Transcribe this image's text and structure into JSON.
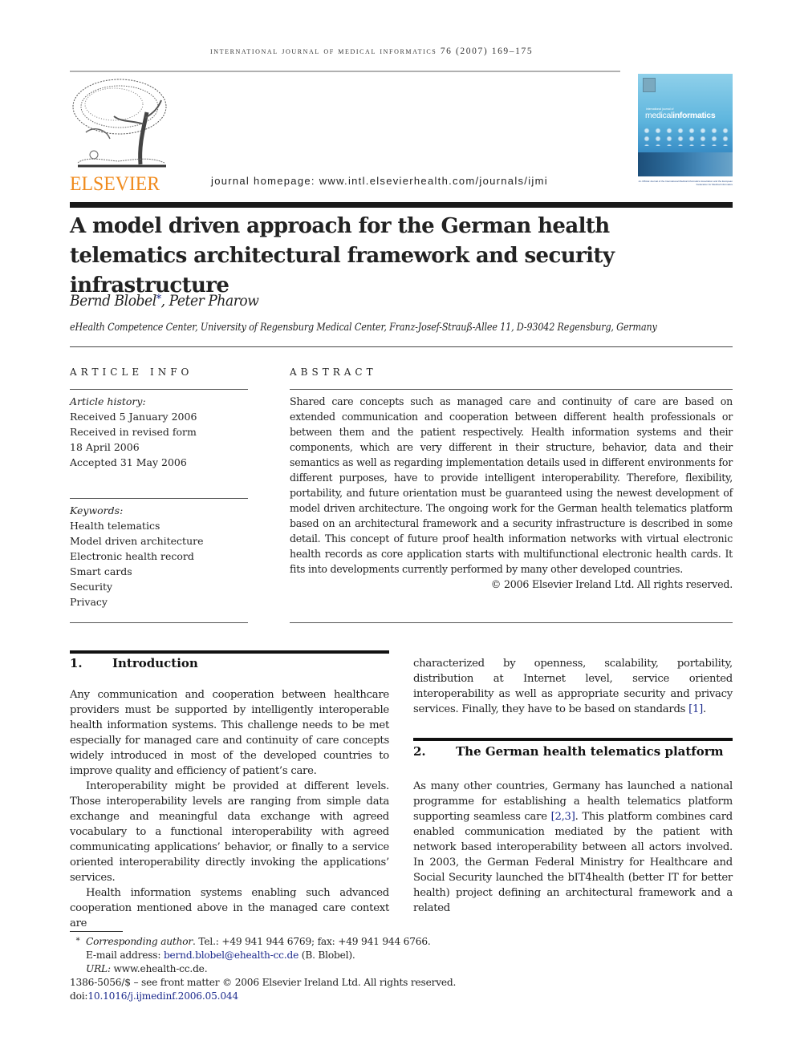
{
  "header": {
    "running_head": "international journal of medical informatics 76 (2007) 169–175",
    "publisher_logo_text": "ELSEVIER",
    "homepage": "journal homepage: www.intl.elsevierhealth.com/journals/ijmi",
    "cover": {
      "kicker": "international journal of",
      "title_light": "medical",
      "title_bold": "informatics",
      "caption": "An Official Journal of the International Medical Informatics Association and the European Federation for Medical Informatics"
    },
    "brand_color": "#f08a1c",
    "link_color": "#1c2a8c"
  },
  "article": {
    "title": "A model driven approach for the German health telematics architectural framework and security infrastructure",
    "authors": [
      {
        "name": "Bernd Blobel",
        "corresponding_mark": "*"
      },
      {
        "name": "Peter Pharow"
      }
    ],
    "author_separator": ", ",
    "affiliation": "eHealth Competence Center, University of Regensburg Medical Center, Franz-Josef-Strauß-Allee 11, D-93042 Regensburg, Germany"
  },
  "article_info": {
    "label": "ARTICLE INFO",
    "history_label": "Article history:",
    "history": [
      "Received 5 January 2006",
      "Received in revised form",
      "18 April 2006",
      "Accepted 31 May 2006"
    ],
    "keywords_label": "Keywords:",
    "keywords": [
      "Health telematics",
      "Model driven architecture",
      "Electronic health record",
      "Smart cards",
      "Security",
      "Privacy"
    ]
  },
  "abstract": {
    "label": "ABSTRACT",
    "text": "Shared care concepts such as managed care and continuity of care are based on extended communication and cooperation between different health professionals or between them and the patient respectively. Health information systems and their components, which are very different in their structure, behavior, data and their semantics as well as regarding implementation details used in different environments for different purposes, have to provide intelligent interoperability. Therefore, flexibility, portability, and future orientation must be guaranteed using the newest development of model driven architecture. The ongoing work for the German health telematics platform based on an architectural framework and a security infrastructure is described in some detail. This concept of future proof health information networks with virtual electronic health records as core application starts with multifunctional electronic health cards. It fits into developments currently performed by many other developed countries.",
    "copyright": "© 2006 Elsevier Ireland Ltd. All rights reserved."
  },
  "sections": [
    {
      "number": "1.",
      "title": "Introduction",
      "paragraphs": [
        "Any communication and cooperation between healthcare providers must be supported by intelligently interoperable health information systems. This challenge needs to be met especially for managed care and continuity of care concepts widely introduced in most of the developed countries to improve quality and efficiency of patient’s care.",
        "Interoperability might be provided at different levels. Those interoperability levels are ranging from simple data exchange and meaningful data exchange with agreed vocabulary to a functional interoperability with agreed communicating applications’ behavior, or finally to a service oriented interoperability directly invoking the applications’ services.",
        "Health information systems enabling such advanced cooperation mentioned above in the managed care context are"
      ],
      "continuation": {
        "text": "characterized by openness, scalability, portability, distribution at Internet level, service oriented interoperability as well as appropriate security and privacy services. Finally, they have to be based on standards ",
        "ref": "[1]",
        "end": "."
      }
    },
    {
      "number": "2.",
      "title": "The German health telematics platform",
      "paragraph_parts": {
        "before_ref": "As many other countries, Germany has launched a national programme for establishing a health telematics platform supporting seamless care ",
        "ref": "[2,3]",
        "after_ref": ". This platform combines card enabled communication mediated by the patient with network based interoperability between all actors involved. In 2003, the German Federal Ministry for Healthcare and Social Security launched the bIT4health (better IT for better health) project defining an architectural framework and a related"
      }
    }
  ],
  "footnotes": {
    "star": "*",
    "corresponding_label": "Corresponding author",
    "contact": ". Tel.: +49 941 944 6769; fax: +49 941 944 6766.",
    "email_label": "E-mail address: ",
    "email": "bernd.blobel@ehealth-cc.de",
    "email_suffix": " (B. Blobel).",
    "url_label": "URL:",
    "url": " www.ehealth-cc.de.",
    "front_matter": "1386-5056/$ – see front matter © 2006 Elsevier Ireland Ltd. All rights reserved.",
    "doi_label": "doi:",
    "doi": "10.1016/j.ijmedinf.2006.05.044"
  }
}
